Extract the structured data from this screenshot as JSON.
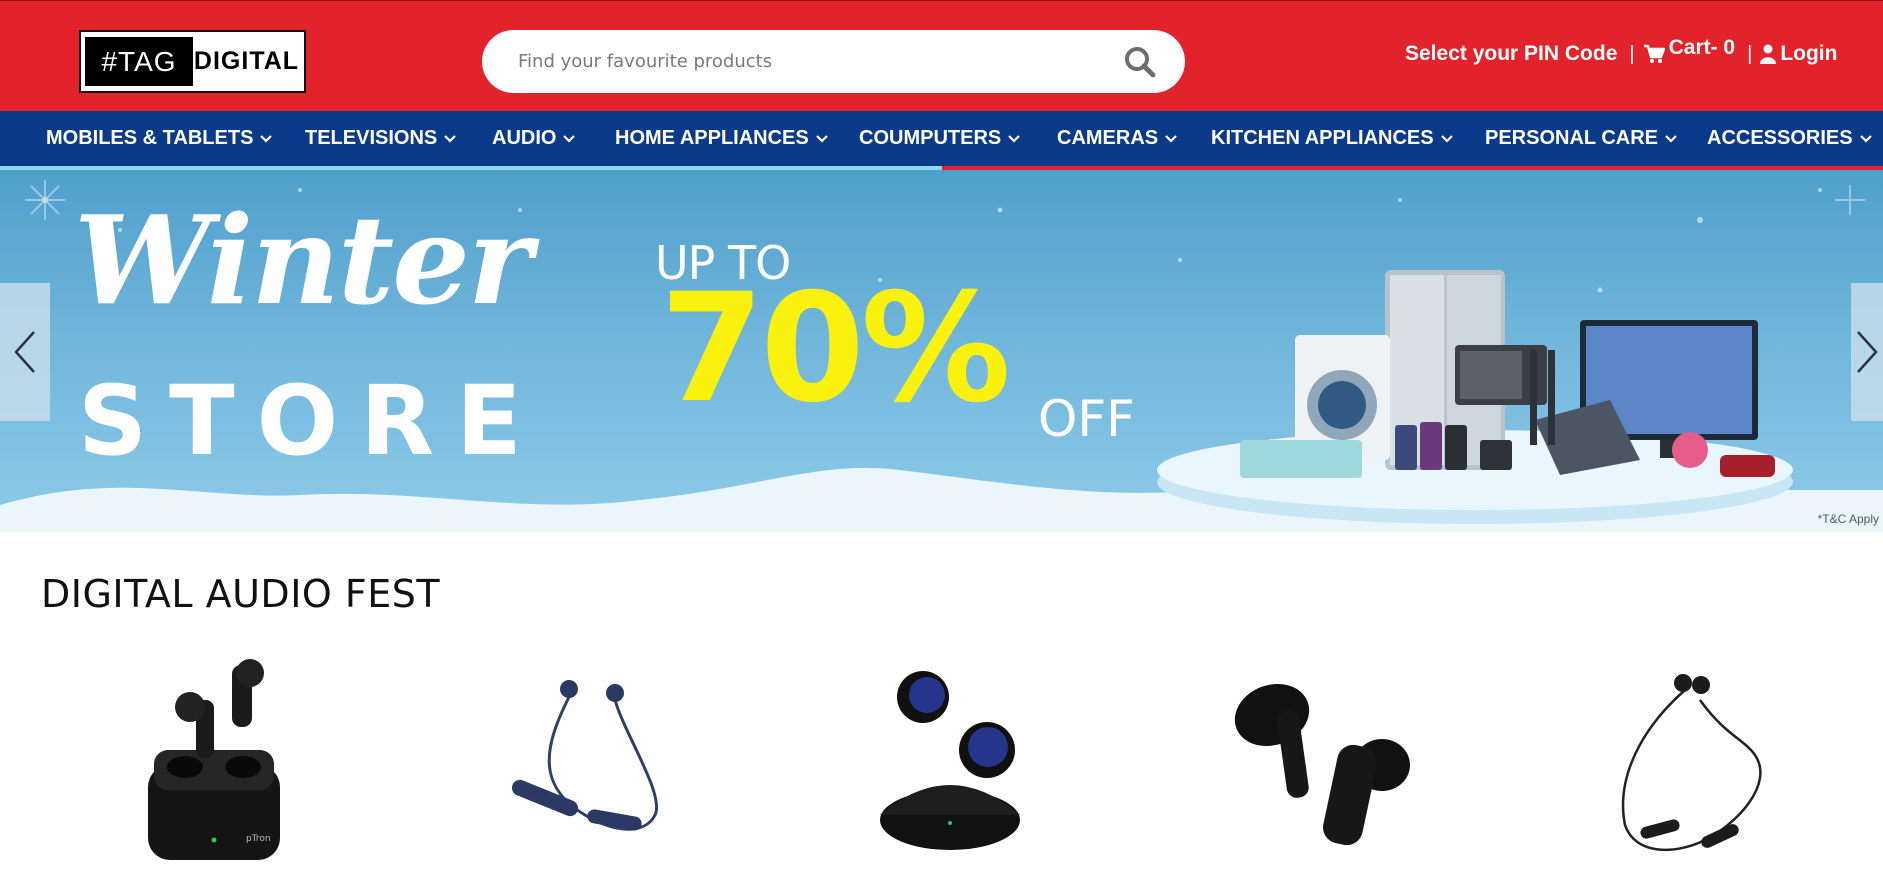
{
  "header": {
    "logo": {
      "left": "#TAG",
      "right": "DIGITAL"
    },
    "search": {
      "placeholder": "Find your favourite products",
      "icon": "search-icon"
    },
    "pin_label": "Select your PIN Code",
    "separator": "|",
    "cart_label": "Cart- 0",
    "login_label": "Login"
  },
  "nav": {
    "items": [
      {
        "label": "MOBILES & TABLETS"
      },
      {
        "label": "TELEVISIONS"
      },
      {
        "label": "AUDIO"
      },
      {
        "label": "HOME APPLIANCES"
      },
      {
        "label": "COUMPUTERS"
      },
      {
        "label": "CAMERAS"
      },
      {
        "label": "KITCHEN APPLIANCES"
      },
      {
        "label": "PERSONAL CARE"
      },
      {
        "label": "ACCESSORIES"
      }
    ]
  },
  "banner": {
    "script_text": "Winter",
    "store_text": "STORE",
    "upto_text": "UP TO",
    "percent_text": "70%",
    "off_text": "OFF",
    "tc_text": "*T&C Apply",
    "slide_progress": 0.5
  },
  "section": {
    "title": "DIGITAL AUDIO FEST",
    "products": [
      {
        "type": "earbuds-case-icon",
        "brand_mark": "pTron"
      },
      {
        "type": "neckband-icon"
      },
      {
        "type": "earbuds-pod-icon"
      },
      {
        "type": "earbuds-pair-icon"
      },
      {
        "type": "wired-neckband-icon"
      }
    ]
  },
  "colors": {
    "header_red": "#e3232b",
    "nav_blue": "#0c3a8a",
    "offer_yellow": "#fbf10f"
  }
}
